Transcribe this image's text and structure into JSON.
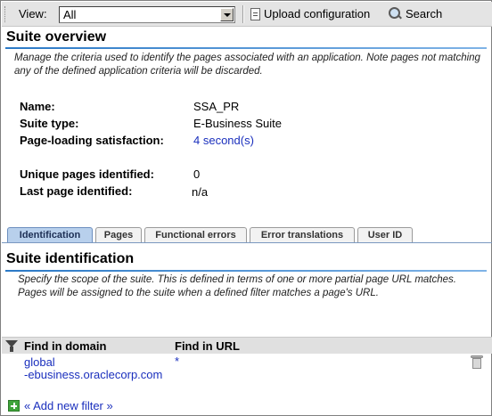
{
  "toolbar": {
    "view_label": "View:",
    "view_value": "All",
    "upload_label": "Upload configuration",
    "search_label": "Search"
  },
  "suite_overview": {
    "title": "Suite overview",
    "description": "Manage the criteria used to identify the pages associated with an application. Note pages not matching any of the defined application criteria will be discarded.",
    "fields": {
      "name_label": "Name:",
      "name_value": "SSA_PR",
      "type_label": "Suite type:",
      "type_value": "E-Business Suite",
      "satisfaction_label": "Page-loading satisfaction:",
      "satisfaction_value": "4 second(s)",
      "unique_label": "Unique pages identified:",
      "unique_value": "0",
      "last_label": "Last page identified:",
      "last_value": "n/a"
    }
  },
  "tabs": [
    {
      "label": "Identification",
      "active": true
    },
    {
      "label": "Pages",
      "active": false
    },
    {
      "label": "Functional errors",
      "active": false
    },
    {
      "label": "Error translations",
      "active": false
    },
    {
      "label": "User ID",
      "active": false
    }
  ],
  "suite_identification": {
    "title": "Suite identification",
    "description": "Specify the scope of the suite. This is defined in terms of one or more partial page URL matches. Pages will be assigned to the suite when a defined filter matches a page's URL.",
    "columns": {
      "domain": "Find in domain",
      "url": "Find in URL"
    },
    "rows": [
      {
        "domain_line1": "global",
        "domain_line2": "-ebusiness.oraclecorp.com",
        "url": "*"
      }
    ],
    "add_filter_label": "« Add new filter »"
  },
  "colors": {
    "accent": "#2b79c6",
    "link": "#1a2fbd",
    "tab_active": "#b8d0ec"
  }
}
